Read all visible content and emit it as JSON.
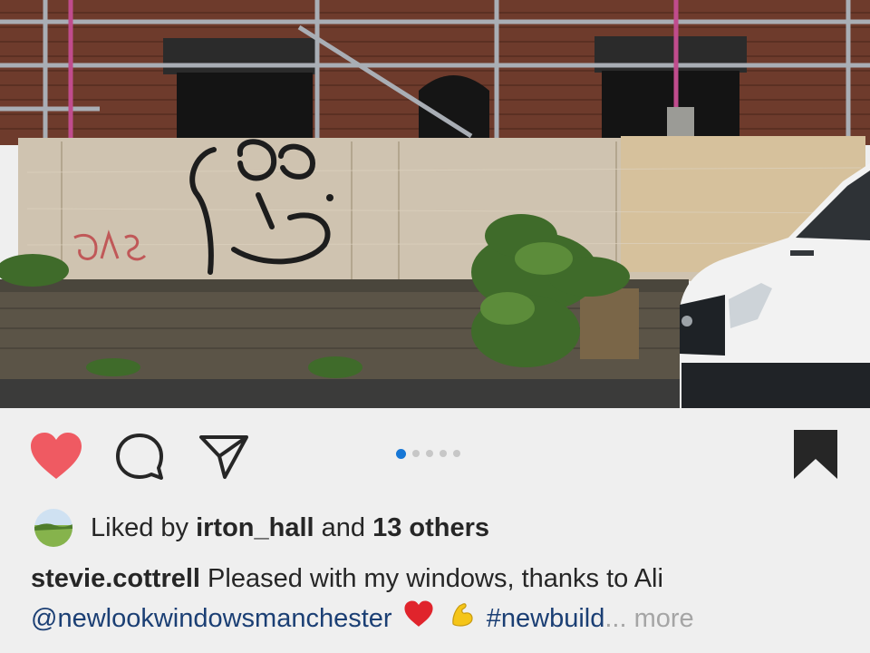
{
  "post": {
    "carousel": {
      "slide_count": 5,
      "active_index": 0
    },
    "likes": {
      "prefix": "Liked by ",
      "user": "irton_hall",
      "joiner": " and ",
      "others": "13 others"
    },
    "caption": {
      "username": "stevie.cottrell",
      "text": " Pleased with my windows, thanks to Ali",
      "mention": "@newlookwindowsmanchester",
      "emojis": [
        "red-heart",
        "flexed-biceps"
      ],
      "hashtag": "#newbuild",
      "ellipsis": "...",
      "more": " more"
    },
    "icons": {
      "like": "heart-icon",
      "comment": "comment-icon",
      "share": "paper-plane-icon",
      "save": "bookmark-icon"
    },
    "colors": {
      "like_active": "#ef5a62",
      "carousel_active": "#1777d6",
      "mention_link": "#1b3f74",
      "text": "#262626",
      "muted": "#a5a5a5"
    }
  }
}
